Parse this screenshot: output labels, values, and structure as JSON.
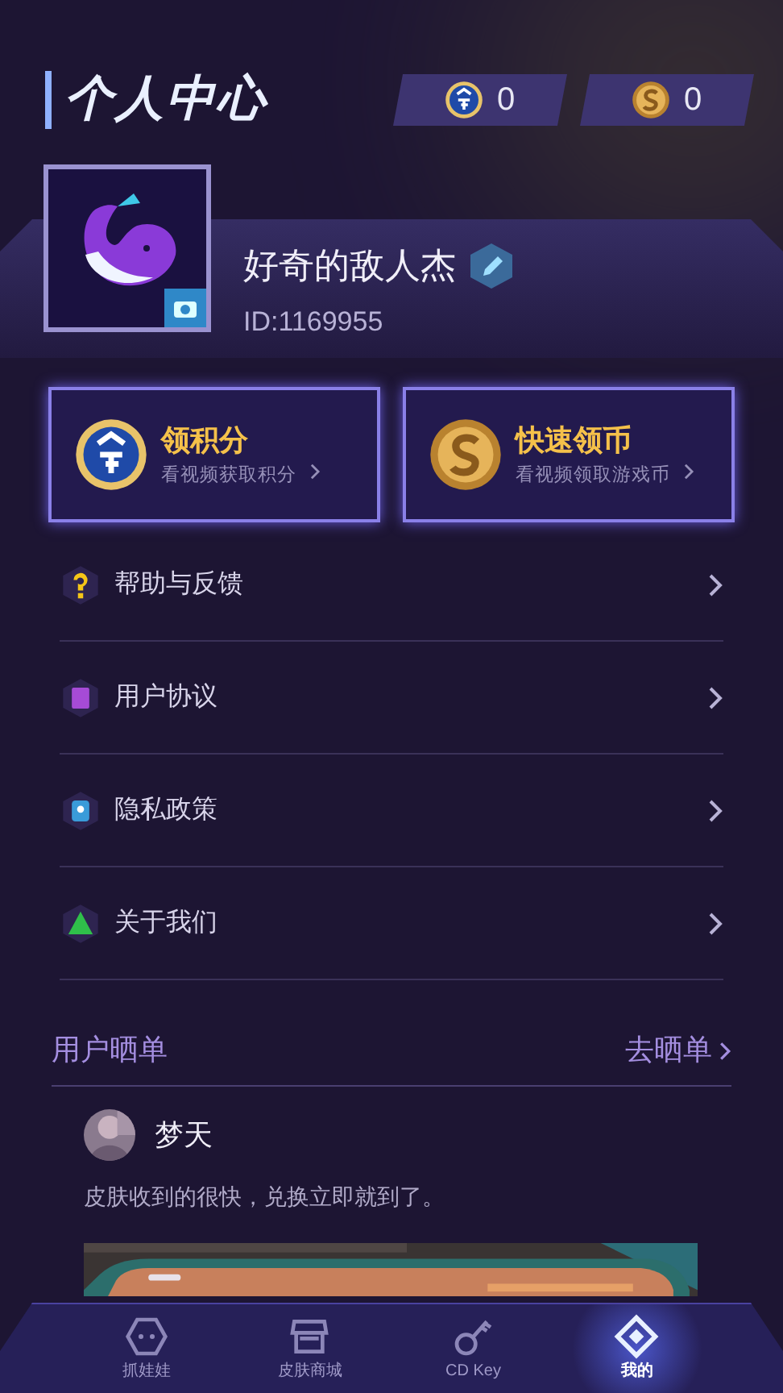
{
  "header": {
    "title": "个人中心",
    "balances": [
      {
        "kind": "points",
        "value": "0"
      },
      {
        "kind": "coins",
        "value": "0"
      }
    ]
  },
  "profile": {
    "name": "好奇的敌人杰",
    "id": "ID:1169955"
  },
  "actions": [
    {
      "kind": "points",
      "title": "领积分",
      "subtitle": "看视频获取积分"
    },
    {
      "kind": "coins",
      "title": "快速领币",
      "subtitle": "看视频领取游戏币"
    }
  ],
  "menu": [
    {
      "label": "帮助与反馈",
      "color": "#f5c518"
    },
    {
      "label": "用户协议",
      "color": "#a64bd6"
    },
    {
      "label": "隐私政策",
      "color": "#3a9bd9"
    },
    {
      "label": "关于我们",
      "color": "#2fbf4a"
    }
  ],
  "showcase": {
    "title": "用户晒单",
    "link": "去晒单",
    "reviews": [
      {
        "user": "梦天",
        "text": "皮肤收到的很快，兑换立即就到了。"
      }
    ]
  },
  "nav": [
    {
      "label": "抓娃娃",
      "selected": false
    },
    {
      "label": "皮肤商城",
      "selected": false
    },
    {
      "label": "CD Key",
      "selected": false
    },
    {
      "label": "我的",
      "selected": true
    }
  ]
}
